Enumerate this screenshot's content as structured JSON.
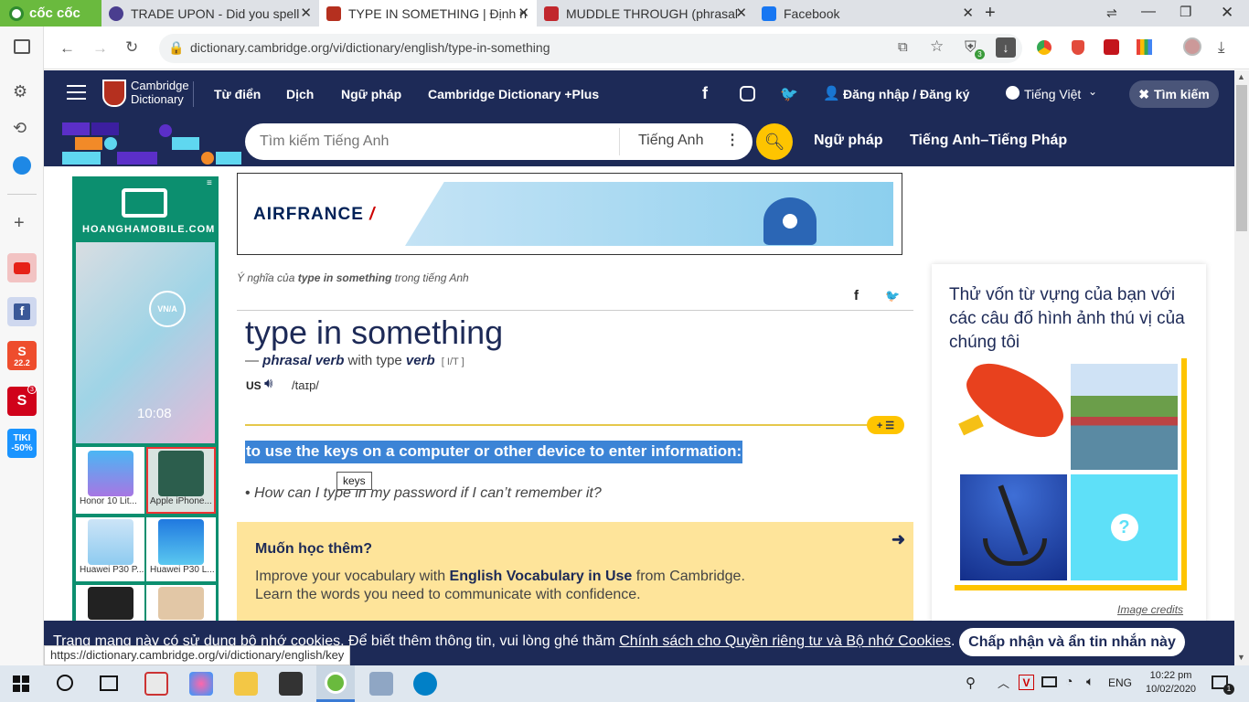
{
  "browser": {
    "brand": "cốc cốc",
    "tabs": [
      {
        "title": "TRADE UPON - Did you spell",
        "color": "#4a3e8f"
      },
      {
        "title": "TYPE IN SOMETHING | Định n",
        "color": "#b5301f"
      },
      {
        "title": "MUDDLE THROUGH (phrasal",
        "color": "#c1272d"
      },
      {
        "title": "Facebook",
        "color": "#1877f2"
      }
    ],
    "new_tab": "+",
    "url": "dictionary.cambridge.org/vi/dictionary/english/type-in-something",
    "status_url": "https://dictionary.cambridge.org/vi/dictionary/english/key",
    "extension_badge": "3"
  },
  "sidebar": {
    "shopee_badge": "22.2",
    "sendo_badge": "3",
    "tiki_label": "TIKI",
    "tiki_discount": "-50%"
  },
  "header": {
    "logo_line1": "Cambridge",
    "logo_line2": "Dictionary",
    "nav": [
      "Từ điển",
      "Dịch",
      "Ngữ pháp",
      "Cambridge Dictionary +Plus"
    ],
    "login": "Đăng nhập / Đăng ký",
    "language": "Tiếng Việt",
    "search_button": "Tìm kiếm"
  },
  "searchbar": {
    "placeholder": "Tìm kiếm Tiếng Anh",
    "dictionary_select": "Tiếng Anh",
    "links": [
      "Ngữ pháp",
      "Tiếng Anh–Tiếng Pháp"
    ]
  },
  "ads": {
    "left_brand": "HOANGHAMOBILE.COM",
    "left_time": "10:08",
    "left_badge": "VN/A",
    "products": [
      "Honor 10 Lit...",
      "Apple iPhone...",
      "Huawei P30 P...",
      "Huawei P30 L..."
    ],
    "top_brand": "AIRFRANCE"
  },
  "entry": {
    "meaning_prefix": "Ý nghĩa của ",
    "meaning_word": "type in something",
    "meaning_suffix": " trong tiếng Anh",
    "headword": "type in something",
    "dash": "— ",
    "pos": "phrasal verb",
    "with_text": " with type ",
    "verb": "verb",
    "grammar": "[ I/T ]",
    "region": "US",
    "pron": "/taɪp/",
    "definition": "to use the keys on a computer or other device to enter information:",
    "tooltip": "keys",
    "example": "How can I type in my password if I can’t remember it?",
    "list_button": "+ ☰"
  },
  "promo": {
    "title": "Muốn học thêm?",
    "line1_prefix": "Improve your vocabulary with ",
    "line1_bold": "English Vocabulary in Use",
    "line1_suffix": " from Cambridge.",
    "line2": "Learn the words you need to communicate with confidence."
  },
  "quiz": {
    "title": "Thử vốn từ vựng của bạn với các câu đố hình ảnh thú vị của chúng tôi",
    "question_mark": "?",
    "credits": "Image credits"
  },
  "cookie": {
    "text_prefix": "Trang mạng này có sử dụng bộ nhớ cookies. Để biết thêm thông tin, vui lòng ghé thăm ",
    "link": "Chính sách cho Quyền riêng tư và Bộ nhớ Cookies",
    "text_suffix": ".",
    "button": "Chấp nhận và ẩn tin nhắn này"
  },
  "taskbar": {
    "lang": "ENG",
    "time": "10:22 pm",
    "date": "10/02/2020",
    "notif": "1"
  }
}
